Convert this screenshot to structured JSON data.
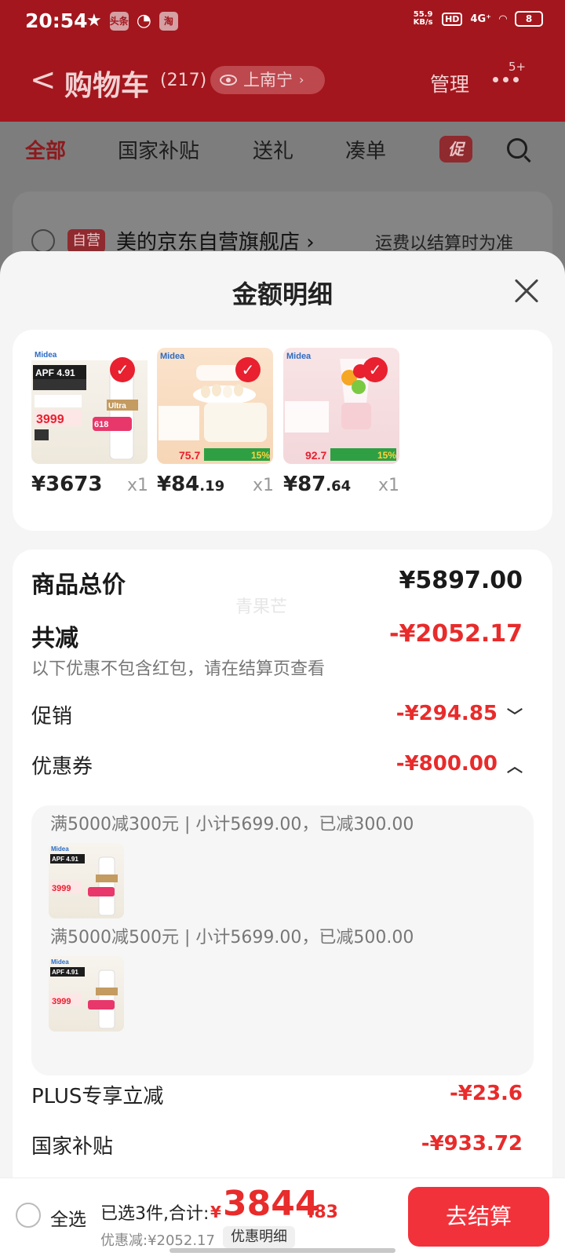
{
  "status_bar": {
    "time": "20:54",
    "net_speed": "55.9 KB/s",
    "hd": "HD",
    "signal": "4G⁺",
    "battery": "8",
    "mini_icons": [
      "头条",
      "淘"
    ]
  },
  "header": {
    "back": "<",
    "title": "购物车",
    "count": "(217)",
    "location": "上南宁",
    "manage": "管理",
    "more_badge": "5+"
  },
  "tabs": [
    {
      "label": "全部"
    },
    {
      "label": "国家补贴"
    },
    {
      "label": "送礼"
    },
    {
      "label": "凑单"
    }
  ],
  "promo_tag": "促",
  "store": {
    "tag": "自营",
    "name": "美的京东自营旗舰店 ›",
    "shipping": "运费以结算时为准"
  },
  "sheet": {
    "title": "金额明细"
  },
  "products": [
    {
      "price_int": "¥3673",
      "price_dec": "",
      "qty": "x1",
      "image": "ac-tower"
    },
    {
      "price_int": "¥84",
      "price_dec": ".19",
      "qty": "x1",
      "image": "egg-steamer"
    },
    {
      "price_int": "¥87",
      "price_dec": ".64",
      "qty": "x1",
      "image": "juicer"
    }
  ],
  "details": {
    "total_label": "商品总价",
    "total_value": "¥5897.00",
    "reduce_label": "共减",
    "reduce_value": "-¥2052.17",
    "note": "以下优惠不包含红包，请在结算页查看",
    "watermark": "青果芒",
    "promo_label": "促销",
    "promo_value": "-¥294.85",
    "coupon_label": "优惠券",
    "coupon_value": "-¥800.00",
    "coupons": [
      {
        "text": "满5000减300元 | 小计5699.00，已减300.00"
      },
      {
        "text": "满5000减500元 | 小计5699.00，已减500.00"
      }
    ],
    "plus_label": "PLUS专享立减",
    "plus_value": "-¥23.6",
    "subsidy_label": "国家补贴",
    "subsidy_value": "-¥933.72"
  },
  "bottom": {
    "select_all": "全选",
    "summary": "已选3件,合计:",
    "yen": "¥",
    "total_int": "3844",
    "total_dec": ".83",
    "discount": "优惠减:¥2052.17",
    "detail_btn": "优惠明细",
    "checkout": "去结算"
  },
  "colors": {
    "accent": "#e82b2b",
    "checkout": "#f2323b",
    "header_dim": "#a3161d"
  }
}
